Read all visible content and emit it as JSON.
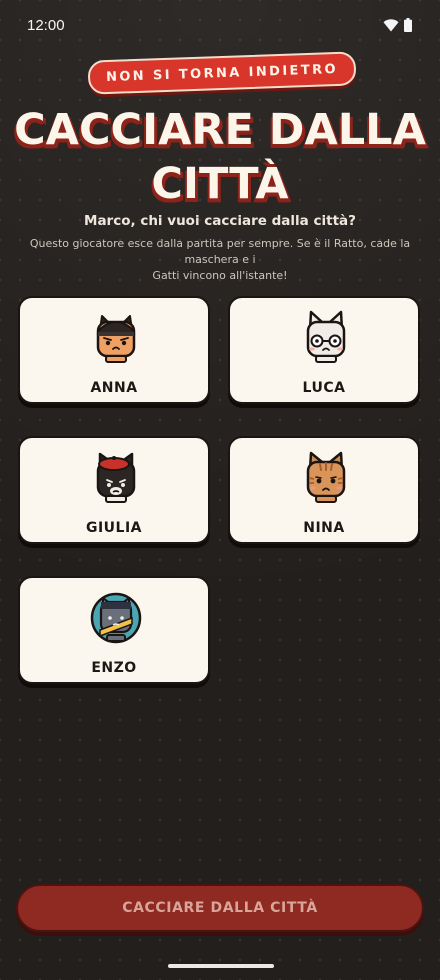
{
  "status_bar": {
    "time": "12:00",
    "icons": [
      "wifi-icon",
      "battery-icon"
    ]
  },
  "header": {
    "badge": "NON SI TORNA INDIETRO",
    "title_line1": "CACCIARE DALLA",
    "title_line2": "CITTÀ",
    "question": "Marco, chi vuoi cacciare dalla città?",
    "explanation_line1": "Questo giocatore esce dalla partita per sempre. Se è il Ratto, cade la maschera e i",
    "explanation_line2": "Gatti vincono all'istante!"
  },
  "players": [
    {
      "name": "ANNA",
      "avatar": "black-cat-with-cap-avatar"
    },
    {
      "name": "LUCA",
      "avatar": "white-cat-with-glasses-avatar"
    },
    {
      "name": "GIULIA",
      "avatar": "black-cat-with-red-beret-avatar"
    },
    {
      "name": "NINA",
      "avatar": "orange-tabby-cat-avatar"
    },
    {
      "name": "ENZO",
      "avatar": "gray-cat-with-banner-avatar"
    }
  ],
  "action": {
    "label": "CACCIARE DALLA CITTÀ",
    "enabled": false
  },
  "colors": {
    "background": "#231f1d",
    "accent_red": "#d9362b",
    "button_red": "#8e2a22",
    "card_bg": "#fbf7ef"
  }
}
